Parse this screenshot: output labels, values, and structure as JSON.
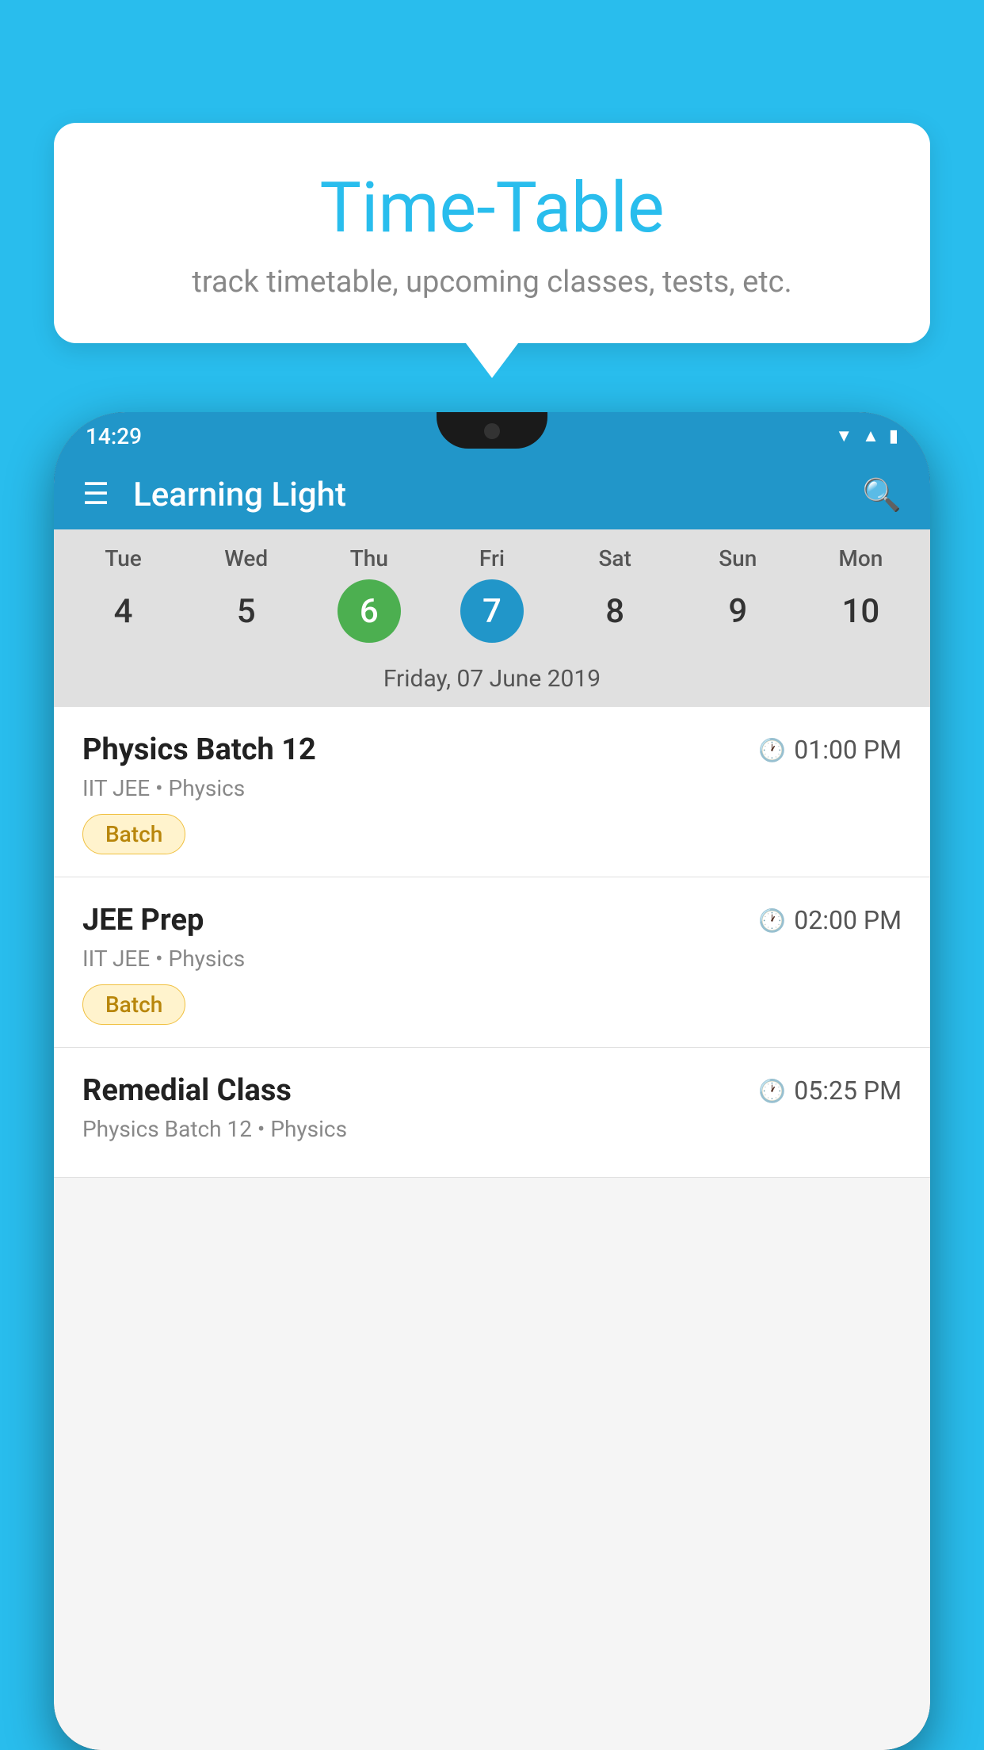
{
  "background_color": "#29BDED",
  "tooltip": {
    "title": "Time-Table",
    "subtitle": "track timetable, upcoming classes, tests, etc."
  },
  "phone": {
    "status_bar": {
      "time": "14:29"
    },
    "app_header": {
      "title": "Learning Light"
    },
    "calendar": {
      "days": [
        {
          "name": "Tue",
          "number": "4",
          "state": "normal"
        },
        {
          "name": "Wed",
          "number": "5",
          "state": "normal"
        },
        {
          "name": "Thu",
          "number": "6",
          "state": "today"
        },
        {
          "name": "Fri",
          "number": "7",
          "state": "selected"
        },
        {
          "name": "Sat",
          "number": "8",
          "state": "normal"
        },
        {
          "name": "Sun",
          "number": "9",
          "state": "normal"
        },
        {
          "name": "Mon",
          "number": "10",
          "state": "normal"
        }
      ],
      "selected_date_label": "Friday, 07 June 2019"
    },
    "schedule": [
      {
        "title": "Physics Batch 12",
        "time": "01:00 PM",
        "subtitle": "IIT JEE • Physics",
        "badge": "Batch"
      },
      {
        "title": "JEE Prep",
        "time": "02:00 PM",
        "subtitle": "IIT JEE • Physics",
        "badge": "Batch"
      },
      {
        "title": "Remedial Class",
        "time": "05:25 PM",
        "subtitle": "Physics Batch 12 • Physics",
        "badge": null
      }
    ]
  }
}
